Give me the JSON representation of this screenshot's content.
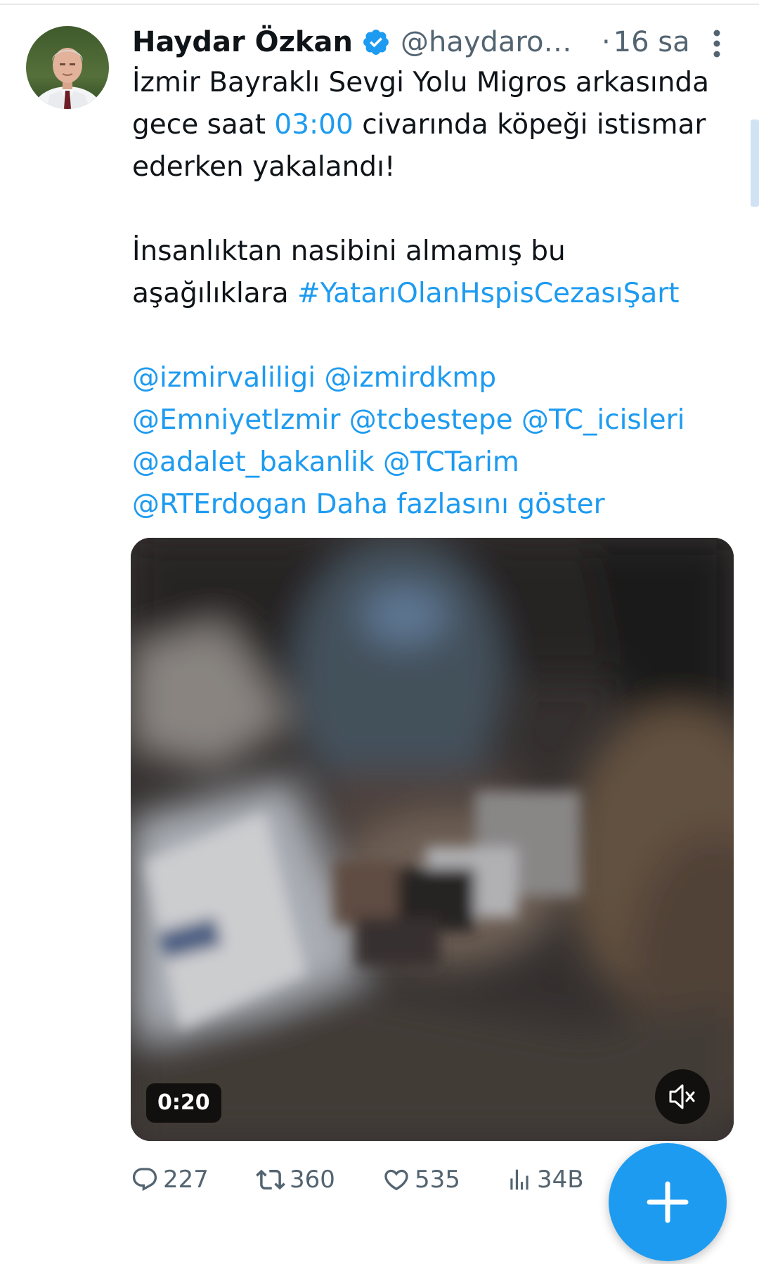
{
  "author": {
    "display_name": "Haydar Özkan",
    "handle": "@haydaroz...",
    "time_sep": "·",
    "time": "16 sa",
    "verified": true
  },
  "tweet": {
    "line1": "İzmir Bayraklı Sevgi Yolu Migros arkasında",
    "line2_pre": "gece saat ",
    "line2_time": "03:00",
    "line2_post": " civarında köpeği istismar",
    "line3": "ederken yakalandı!",
    "line4": "İnsanlıktan nasibini almamış bu",
    "line5_pre": "aşağılıklara ",
    "hashtag": "#YatarıOlanHspisCezasıŞart",
    "mentions": {
      "m1": "@izmirvaliligi",
      "m2": "@izmirdkmp",
      "m3": "@EmniyetIzmir",
      "m4": "@tcbestepe",
      "m5": "@TC_icisleri",
      "m6": "@adalet_bakanlik",
      "m7": "@TCTarim",
      "m8": "@RTErdogan"
    },
    "show_more": "Daha fazlasını göster"
  },
  "media": {
    "duration": "0:20"
  },
  "actions": {
    "replies": "227",
    "retweets": "360",
    "likes": "535",
    "views": "34B"
  },
  "icons": {
    "verified": "verified-badge-icon",
    "more": "more-vertical-icon",
    "reply": "reply-icon",
    "retweet": "retweet-icon",
    "like": "heart-icon",
    "views": "views-chart-icon",
    "mute": "volume-muted-icon",
    "compose": "plus-icon"
  },
  "colors": {
    "link": "#1d9bf0",
    "text": "#0f1419",
    "secondary": "#536471"
  }
}
